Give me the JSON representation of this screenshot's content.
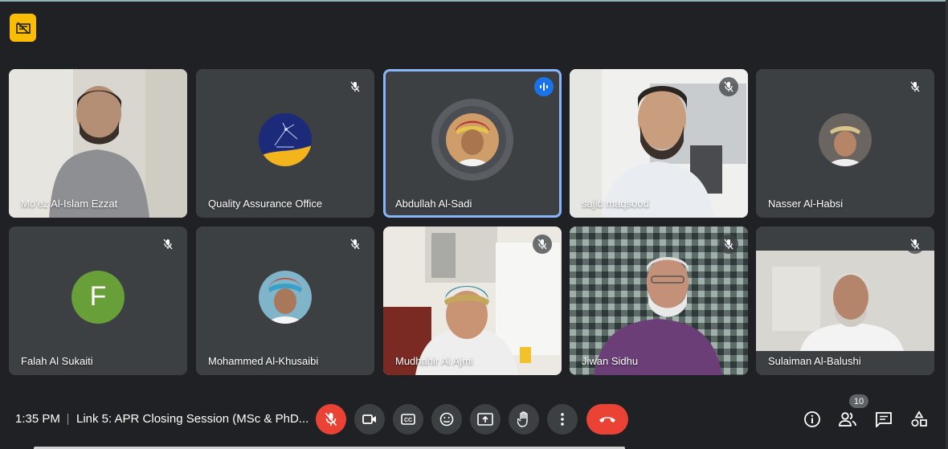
{
  "participants": [
    {
      "name": "Mo'ez Al-Islam Ezzat",
      "type": "video",
      "muted": false
    },
    {
      "name": "Quality Assurance Office",
      "type": "logo",
      "muted": true
    },
    {
      "name": "Abdullah Al-Sadi",
      "type": "avatar",
      "muted": false,
      "speaking": true
    },
    {
      "name": "sajid maqsood",
      "type": "video",
      "muted": true
    },
    {
      "name": "Nasser Al-Habsi",
      "type": "avatar",
      "muted": true
    },
    {
      "name": "Falah Al Sukaiti",
      "type": "letter",
      "letter": "F",
      "muted": true
    },
    {
      "name": "Mohammed Al-Khusaibi",
      "type": "avatar",
      "muted": true
    },
    {
      "name": "Mudhahir Al Ajmi",
      "type": "video",
      "muted": true
    },
    {
      "name": "Jiwan Sidhu",
      "type": "video",
      "muted": true
    },
    {
      "name": "Sulaiman Al-Balushi",
      "type": "video",
      "muted": true
    }
  ],
  "footer": {
    "time": "1:35 PM",
    "meeting_title": "Link 5: APR Closing Session (MSc & PhD...",
    "participant_count": "10"
  },
  "controls": [
    "mic-off-icon",
    "camera-icon",
    "captions-icon",
    "emoji-icon",
    "present-icon",
    "raise-hand-icon",
    "more-options-icon",
    "hang-up-icon"
  ],
  "right_controls": [
    "info-icon",
    "people-icon",
    "chat-icon",
    "activities-icon"
  ],
  "colors": {
    "accent": "#8ab4f8",
    "danger": "#ea4335",
    "badge": "#fbbc04",
    "letter_avatar": "#689f38"
  }
}
